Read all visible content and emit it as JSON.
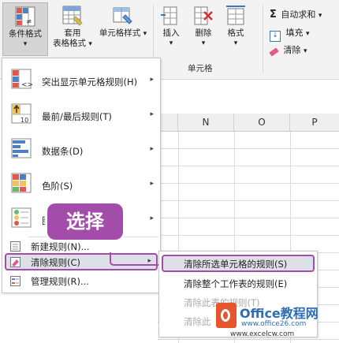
{
  "ribbon": {
    "conditional_format": "条件格式",
    "conditional_format_arrow": "▾",
    "table_format_line1": "套用",
    "table_format_line2": "表格格式",
    "table_format_arrow": "▾",
    "cell_styles": "单元格样式",
    "cell_styles_arrow": "▾",
    "insert": "插入",
    "insert_arrow": "▾",
    "delete": "删除",
    "delete_arrow": "▾",
    "format": "格式",
    "format_arrow": "▾",
    "cells_group": "单元格",
    "autosum": "自动求和",
    "autosum_arrow": "▾",
    "fill": "填充",
    "fill_arrow": "▾",
    "clear": "清除",
    "clear_arrow": "▾"
  },
  "columns": [
    "N",
    "O",
    "P"
  ],
  "menu": {
    "items": [
      {
        "label": "突出显示单元格规则(H)",
        "icon": "highlight-rules-icon"
      },
      {
        "label": "最前/最后规则(T)",
        "icon": "top-bottom-rules-icon"
      },
      {
        "label": "数据条(D)",
        "icon": "data-bars-icon"
      },
      {
        "label": "色阶(S)",
        "icon": "color-scales-icon"
      },
      {
        "label": "图",
        "icon": "icon-sets-icon"
      }
    ],
    "new_rule": "新建规则(N)...",
    "clear_rules": "清除规则(C)",
    "manage_rules": "管理规则(R)...",
    "arrow": "▸"
  },
  "submenu": {
    "clear_selected": "清除所选单元格的规则(S)",
    "clear_sheet": "清除整个工作表的规则(E)",
    "clear_table": "清除此表的规则(T)",
    "clear_pivot": "清除此"
  },
  "callout": "选择",
  "watermark": {
    "brand": "Office教程网",
    "url1": "www.office26.com",
    "url2": "www.excelcw.com"
  },
  "colors": {
    "accent": "#a44caa",
    "ribbon_bg": "#f3f3f3",
    "selected_bg": "#dde0e6",
    "office_orange": "#e4572e"
  }
}
